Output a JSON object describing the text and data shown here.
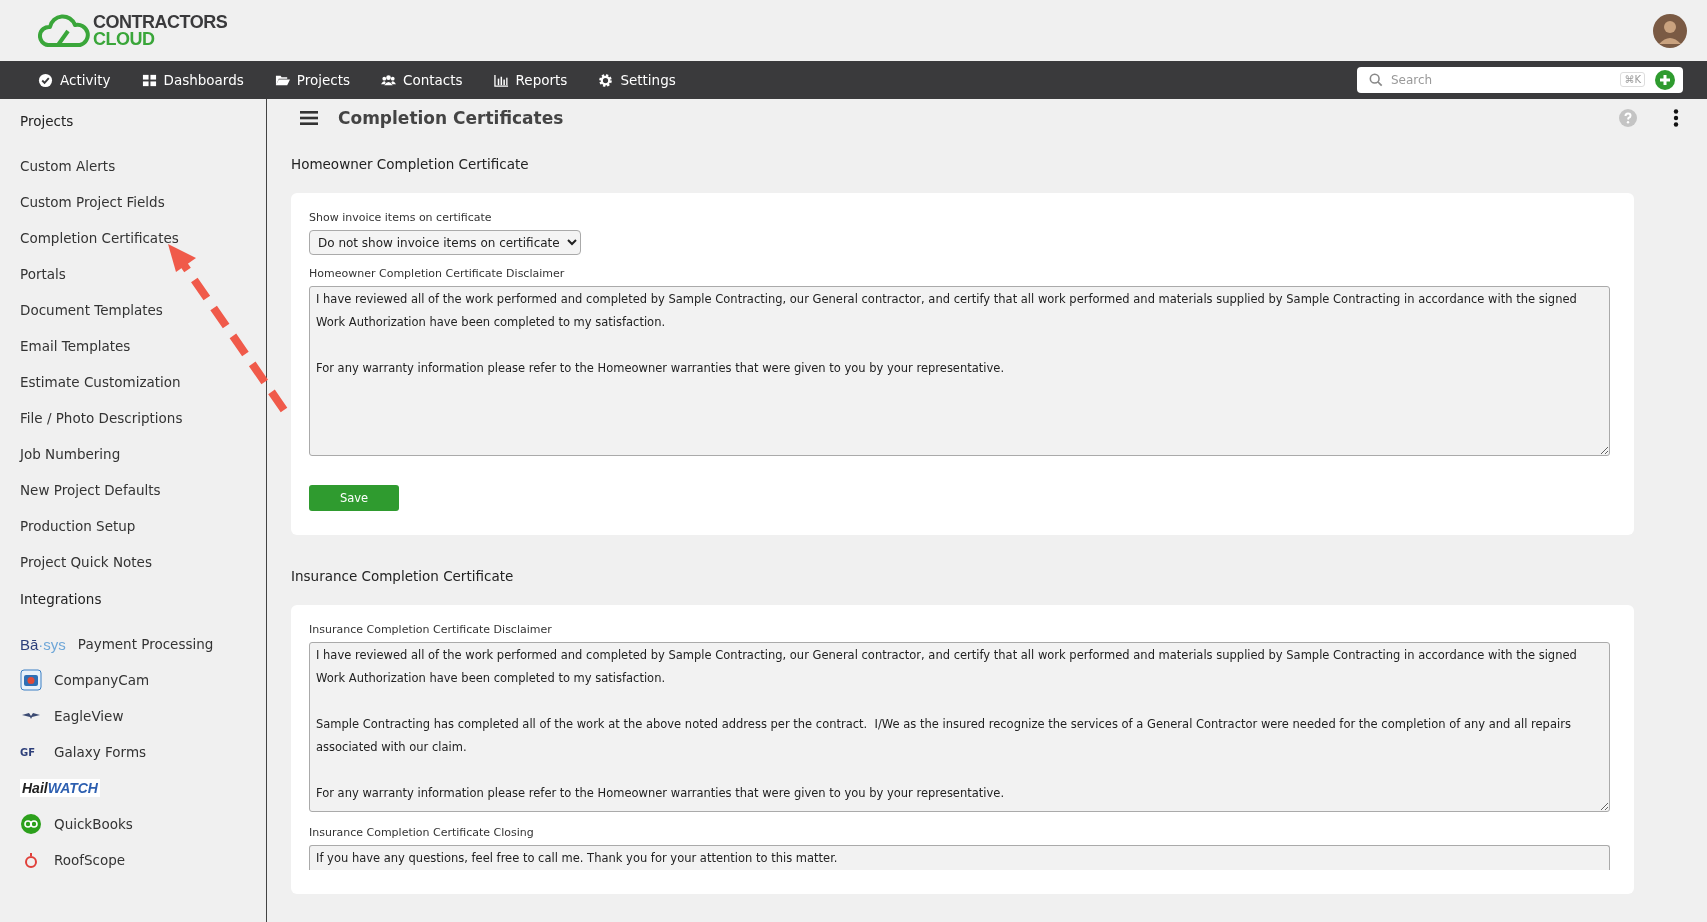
{
  "brand": {
    "line1": "CONTRACTORS",
    "line2": "CLOUD"
  },
  "nav": [
    {
      "label": "Activity",
      "kind": "activity"
    },
    {
      "label": "Dashboards",
      "kind": "dashboards"
    },
    {
      "label": "Projects",
      "kind": "projects"
    },
    {
      "label": "Contacts",
      "kind": "contacts"
    },
    {
      "label": "Reports",
      "kind": "reports"
    },
    {
      "label": "Settings",
      "kind": "settings"
    }
  ],
  "search": {
    "placeholder": "Search",
    "shortcut": "⌘K"
  },
  "sidebar": {
    "sections": [
      {
        "title": "Projects",
        "items": [
          {
            "label": "Custom Alerts"
          },
          {
            "label": "Custom Project Fields"
          },
          {
            "label": "Completion Certificates"
          },
          {
            "label": "Portals"
          },
          {
            "label": "Document Templates"
          },
          {
            "label": "Email Templates"
          },
          {
            "label": "Estimate Customization"
          },
          {
            "label": "File / Photo Descriptions"
          },
          {
            "label": "Job Numbering"
          },
          {
            "label": "New Project Defaults"
          },
          {
            "label": "Production Setup"
          },
          {
            "label": "Project Quick Notes"
          }
        ]
      },
      {
        "title": "Integrations",
        "items": [
          {
            "label": "Payment Processing",
            "kind": "basys",
            "logo_a": "Bā",
            "logo_b": "·sys"
          },
          {
            "label": "CompanyCam",
            "kind": "camera"
          },
          {
            "label": "EagleView",
            "kind": "eagle"
          },
          {
            "label": "Galaxy Forms",
            "kind": "galaxy",
            "logo_a": "GF"
          },
          {
            "kind": "hailwatch",
            "logo_a": "Hail",
            "logo_b": "WATCH"
          },
          {
            "label": "QuickBooks",
            "kind": "qb"
          },
          {
            "label": "RoofScope",
            "kind": "roof"
          }
        ]
      }
    ]
  },
  "page": {
    "title": "Completion Certificates"
  },
  "sections": [
    {
      "title": "Homeowner Completion Certificate",
      "fields": [
        {
          "kind": "select",
          "label": "Show invoice items on certificate",
          "value": "Do not show invoice items on certificate"
        },
        {
          "kind": "textarea",
          "label": "Homeowner Completion Certificate Disclaimer",
          "value": "I have reviewed all of the work performed and completed by Sample Contracting, our General contractor, and certify that all work performed and materials supplied by Sample Contracting in accordance with the signed Work Authorization have been completed to my satisfaction.\n\nFor any warranty information please refer to the Homeowner warranties that were given to you by your representative."
        }
      ],
      "button": "Save"
    },
    {
      "title": "Insurance Completion Certificate",
      "fields": [
        {
          "kind": "textarea",
          "label": "Insurance Completion Certificate Disclaimer",
          "value": "I have reviewed all of the work performed and completed by Sample Contracting, our General contractor, and certify that all work performed and materials supplied by Sample Contracting in accordance with the signed Work Authorization have been completed to my satisfaction.\n\nSample Contracting has completed all of the work at the above noted address per the contract.  I/We as the insured recognize the services of a General Contractor were needed for the completion of any and all repairs associated with our claim.\n\nFor any warranty information please refer to the Homeowner warranties that were given to you by your representative."
        },
        {
          "kind": "closing",
          "label": "Insurance Completion Certificate Closing",
          "value": "If you have any questions, feel free to call me. Thank you for your attention to this matter."
        }
      ]
    }
  ]
}
